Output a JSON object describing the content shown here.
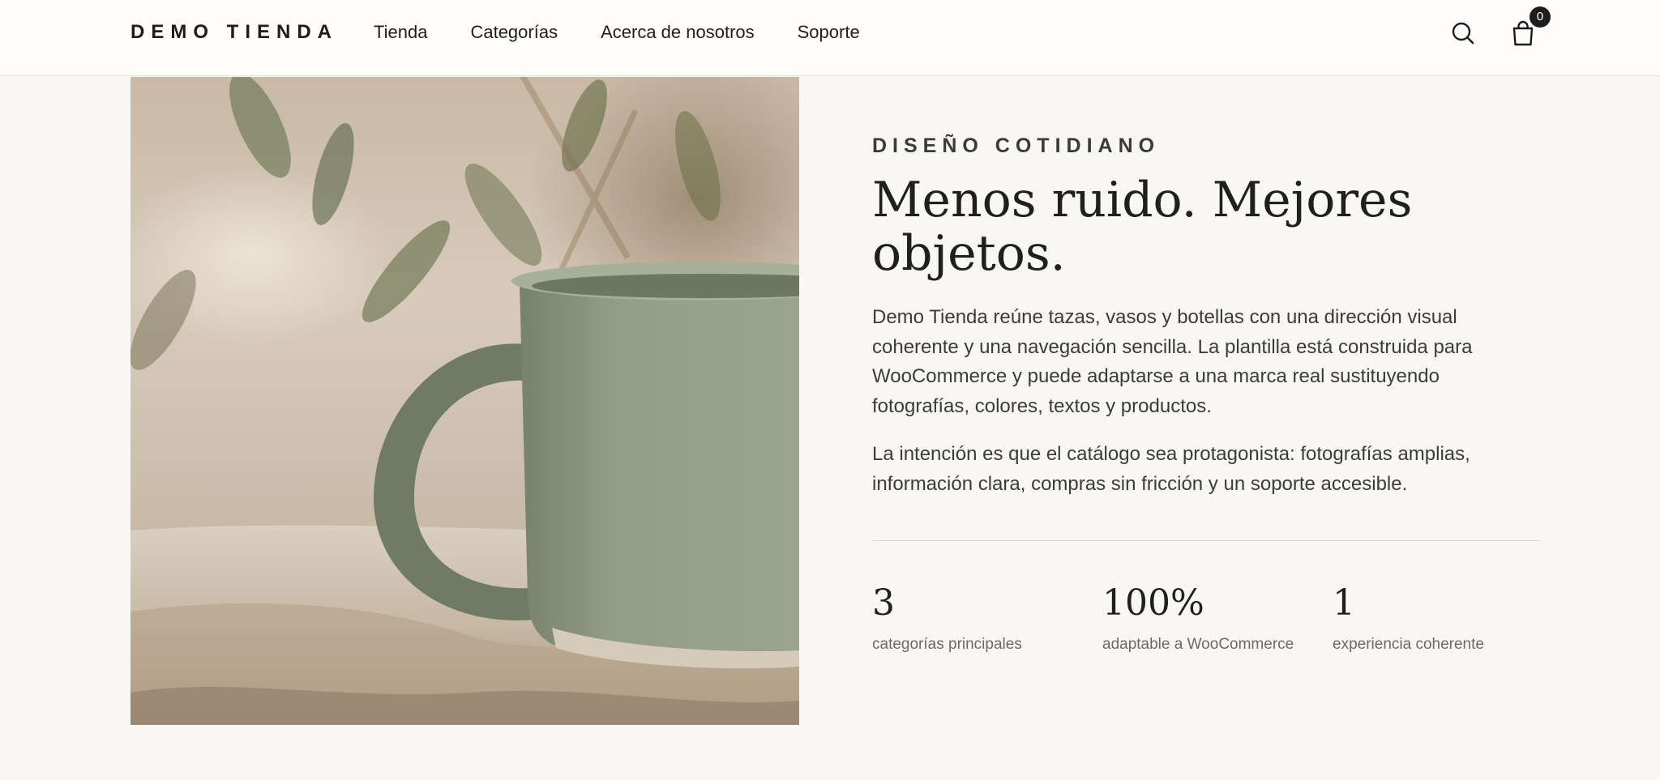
{
  "brand": {
    "logo": "DEMO TIENDA"
  },
  "nav": {
    "items": [
      {
        "label": "Tienda"
      },
      {
        "label": "Categorías"
      },
      {
        "label": "Acerca de nosotros"
      },
      {
        "label": "Soporte"
      }
    ]
  },
  "header_actions": {
    "search_icon": "search-icon",
    "cart_icon": "shopping-bag-icon",
    "cart_count": "0"
  },
  "hero": {
    "image_icon": "mug-photo",
    "eyebrow": "DISEÑO COTIDIANO",
    "title": "Menos ruido. Mejores objetos.",
    "paragraphs": [
      "Demo Tienda reúne tazas, vasos y botellas con una dirección visual coherente y una navegación sencilla. La plantilla está construida para WooCommerce y puede adaptarse a una marca real sustituyendo fotografías, colores, textos y productos.",
      "La intención es que el catálogo sea protagonista: fotografías amplias, información clara, compras sin fricción y un soporte accesible."
    ],
    "stats": [
      {
        "value": "3",
        "label": "categorías principales"
      },
      {
        "value": "100%",
        "label": "adaptable a WooCommerce"
      },
      {
        "value": "1",
        "label": "experiencia coherente"
      }
    ]
  },
  "colors": {
    "background": "#f9f7f3",
    "header_background": "#fefdfb",
    "text": "#1f1f1f",
    "muted_text": "#6a6a6a",
    "mug_green": "#8e9a80"
  }
}
